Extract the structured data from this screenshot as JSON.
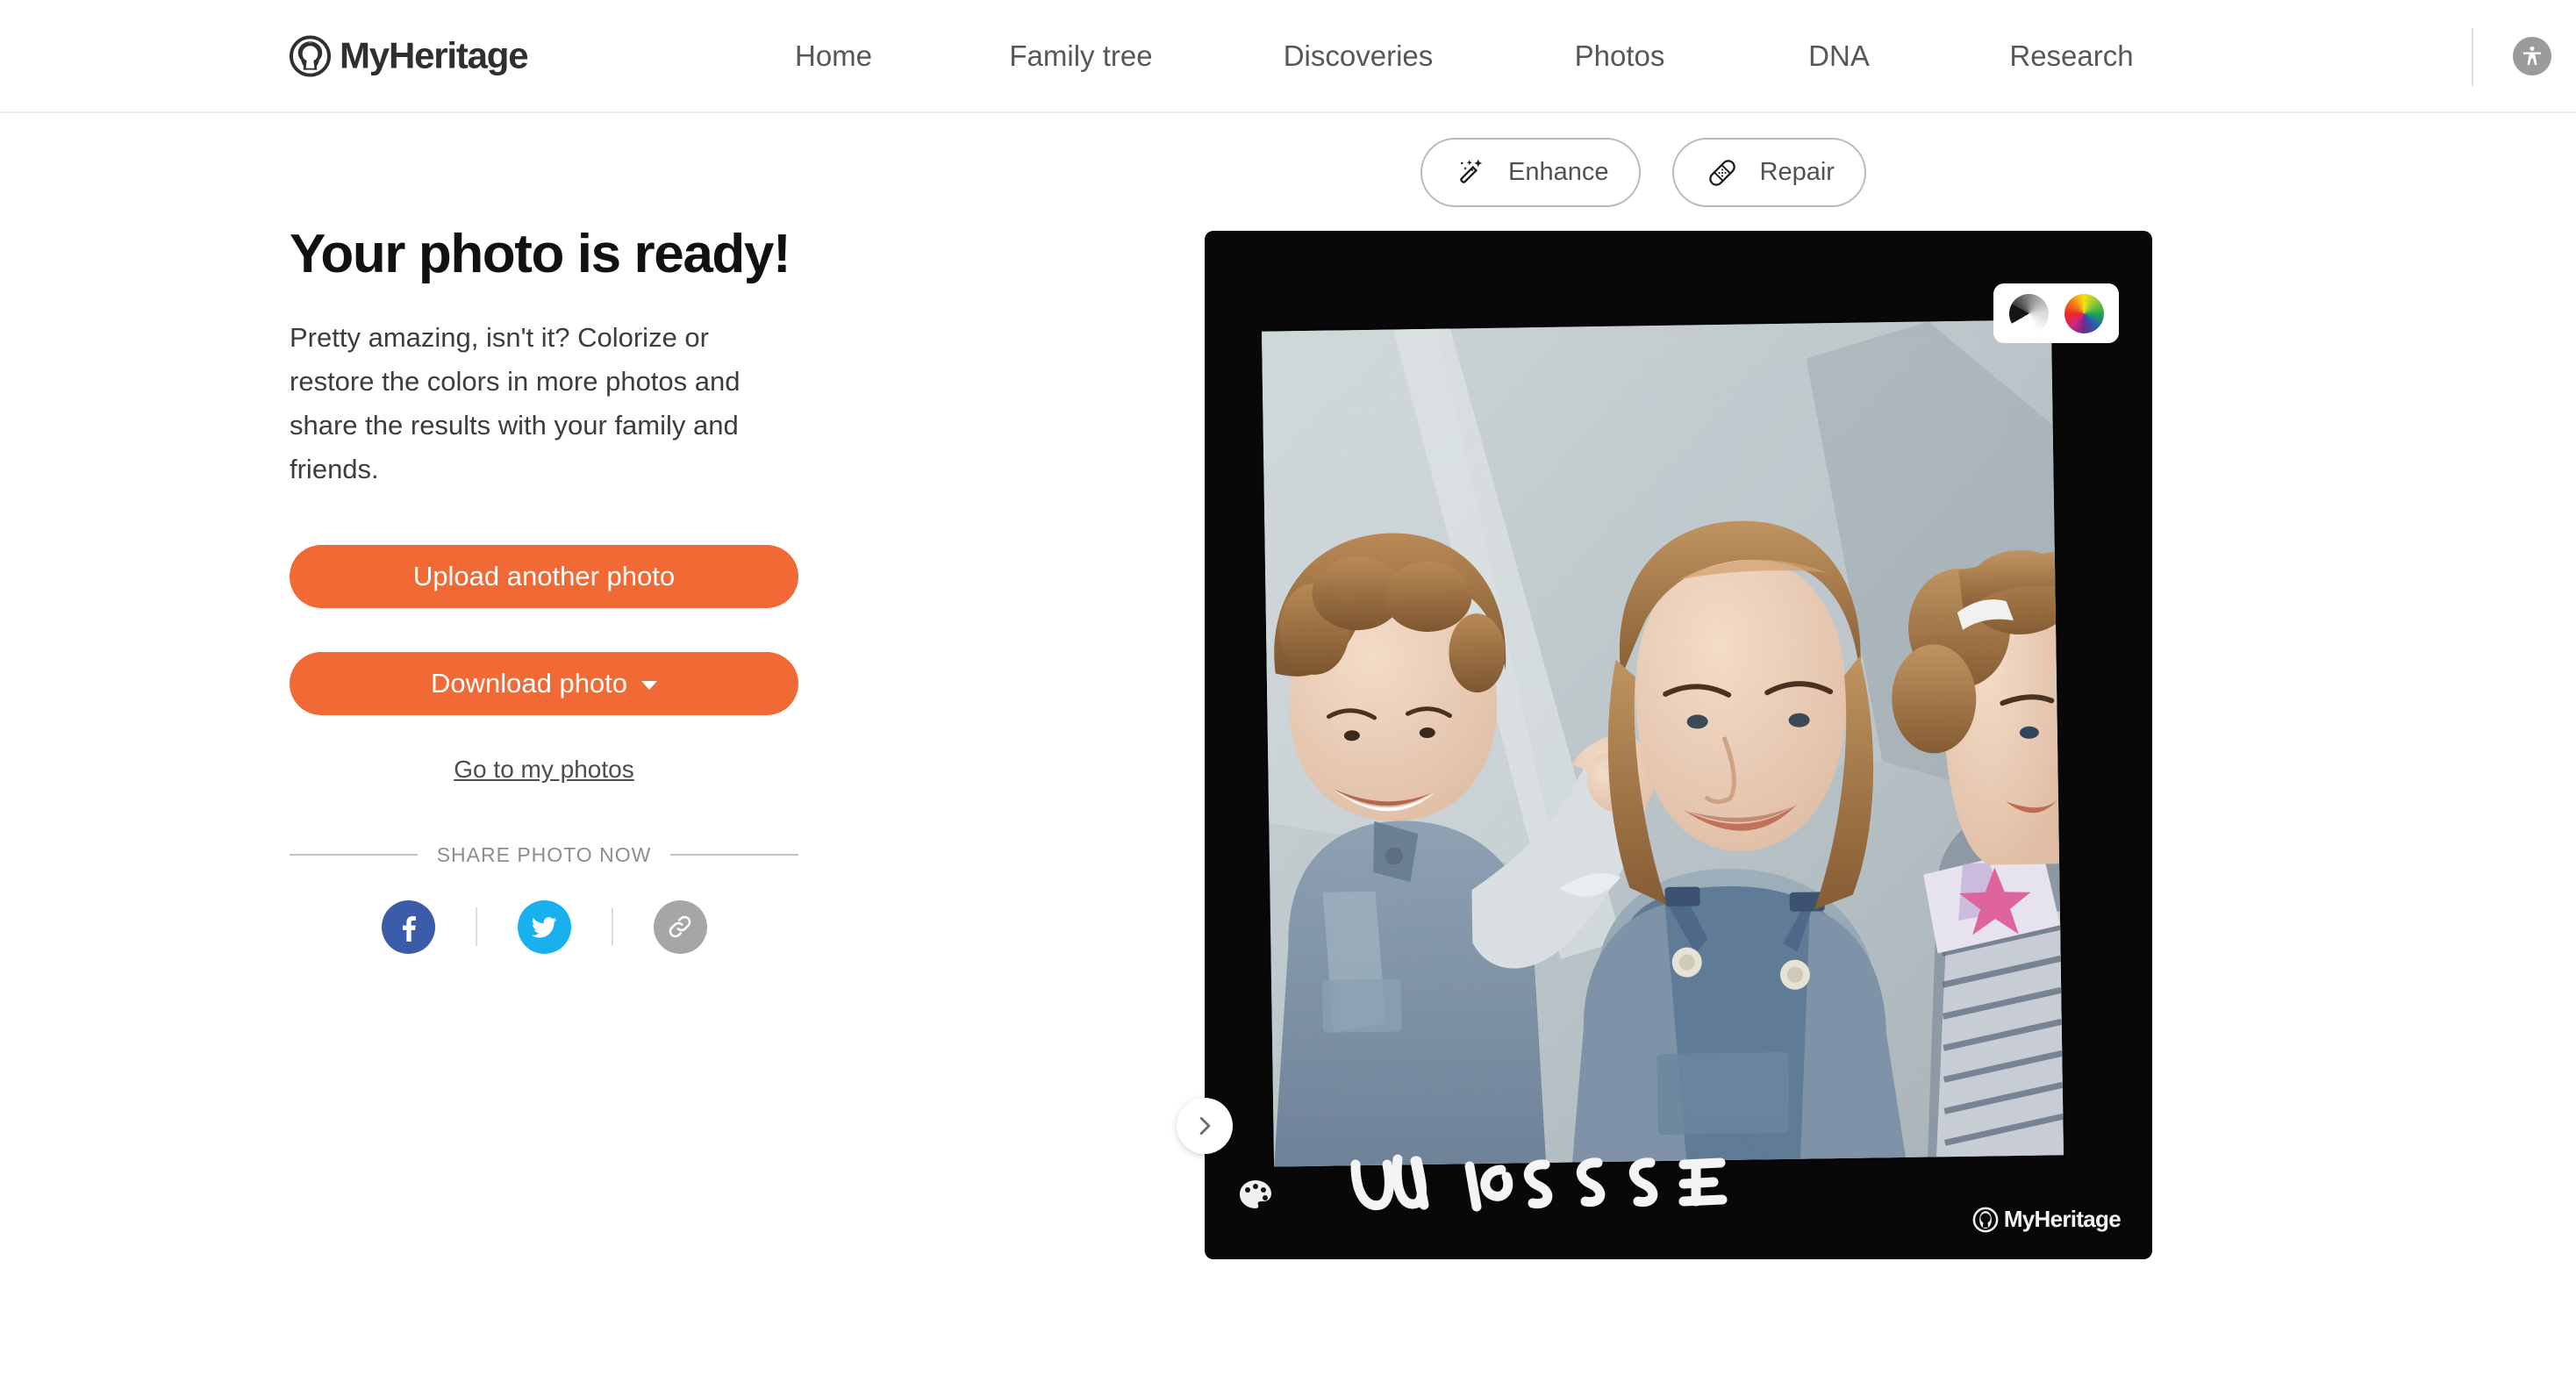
{
  "header": {
    "logo": {
      "icon": "myheritage-tree-logo-icon",
      "text": "MyHeritage"
    },
    "nav": [
      {
        "label": "Home"
      },
      {
        "label": "Family tree"
      },
      {
        "label": "Discoveries"
      },
      {
        "label": "Photos"
      },
      {
        "label": "DNA"
      },
      {
        "label": "Research"
      }
    ],
    "accessibility": {
      "icon": "accessibility-icon",
      "color": "#9b9b9b"
    }
  },
  "tools": [
    {
      "label": "Enhance",
      "icon": "magic-wand-icon"
    },
    {
      "label": "Repair",
      "icon": "bandage-icon"
    }
  ],
  "main": {
    "headline": "Your photo is ready!",
    "subcopy": "Pretty amazing, isn't it? Colorize or restore the colors in more photos and share the results with your family and friends.",
    "upload_button": "Upload another photo",
    "download_button": "Download photo",
    "go_to_photos_link": "Go to my photos",
    "share_label": "SHARE PHOTO NOW",
    "share_buttons": [
      {
        "name": "facebook",
        "icon": "facebook-icon",
        "color": "#3b5ca8"
      },
      {
        "name": "twitter",
        "icon": "twitter-icon",
        "color": "#19b0ef"
      },
      {
        "name": "copy-link",
        "icon": "link-icon",
        "color": "#a6a6a6"
      }
    ]
  },
  "photo": {
    "frame_color": "#080808",
    "watermark_text": "MyHeritage",
    "handwriting_text": "UA IPSSSE",
    "color_toggle": {
      "grayscale_option": "black-and-white",
      "color_option": "color",
      "selected": "color"
    },
    "next_arrow": "next-photo",
    "palette_icon": "palette-icon"
  },
  "colors": {
    "accent_orange": "#f16a35",
    "nav_text": "#55585a",
    "headline_text": "#111111",
    "body_text": "#3b3e40",
    "border_gray": "#b9b9b9"
  }
}
